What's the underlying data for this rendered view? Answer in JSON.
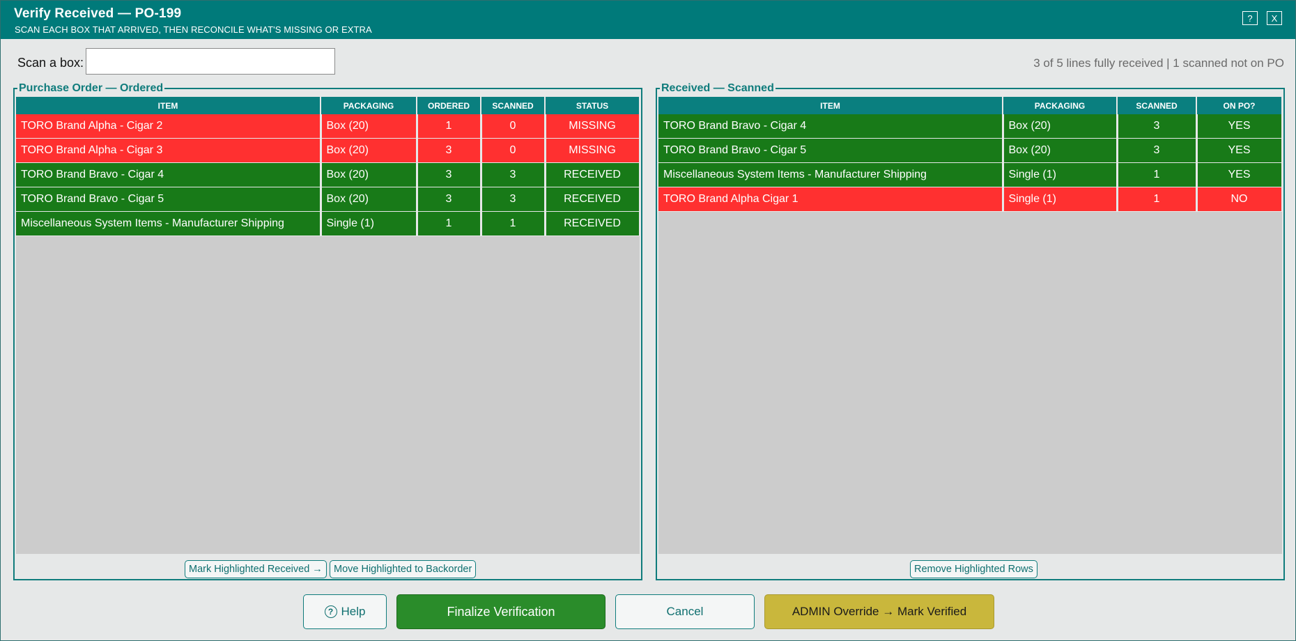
{
  "window": {
    "title": "Verify Received — PO-199",
    "subtitle": "SCAN EACH BOX THAT ARRIVED, THEN RECONCILE WHAT'S MISSING OR EXTRA",
    "help_label": "?",
    "close_label": "X"
  },
  "scan": {
    "label": "Scan a box:",
    "value": "",
    "placeholder": ""
  },
  "summary": "3 of 5 lines fully received | 1 scanned not on PO",
  "ordered_panel": {
    "title": "Purchase Order — Ordered",
    "columns": [
      "ITEM",
      "PACKAGING",
      "ORDERED",
      "SCANNED",
      "STATUS"
    ],
    "rows": [
      {
        "item": "TORO Brand Alpha - Cigar 2",
        "packaging": "Box (20)",
        "ordered": "1",
        "scanned": "0",
        "status": "MISSING",
        "color": "#ff3030"
      },
      {
        "item": "TORO Brand Alpha - Cigar 3",
        "packaging": "Box (20)",
        "ordered": "3",
        "scanned": "0",
        "status": "MISSING",
        "color": "#ff3030"
      },
      {
        "item": "TORO Brand Bravo - Cigar 4",
        "packaging": "Box (20)",
        "ordered": "3",
        "scanned": "3",
        "status": "RECEIVED",
        "color": "#187a18"
      },
      {
        "item": "TORO Brand Bravo - Cigar 5",
        "packaging": "Box (20)",
        "ordered": "3",
        "scanned": "3",
        "status": "RECEIVED",
        "color": "#187a18"
      },
      {
        "item": "Miscellaneous System Items - Manufacturer Shipping",
        "packaging": "Single (1)",
        "ordered": "1",
        "scanned": "1",
        "status": "RECEIVED",
        "color": "#187a18"
      }
    ],
    "mark_received_label": "Mark Highlighted Received →",
    "backorder_label": "Move Highlighted to Backorder"
  },
  "scanned_panel": {
    "title": "Received — Scanned",
    "columns": [
      "ITEM",
      "PACKAGING",
      "SCANNED",
      "ON PO?"
    ],
    "rows": [
      {
        "item": "TORO Brand Bravo - Cigar 4",
        "packaging": "Box (20)",
        "scanned": "3",
        "on_po": "YES",
        "color": "#187a18"
      },
      {
        "item": "TORO Brand Bravo - Cigar 5",
        "packaging": "Box (20)",
        "scanned": "3",
        "on_po": "YES",
        "color": "#187a18"
      },
      {
        "item": "Miscellaneous System Items - Manufacturer Shipping",
        "packaging": "Single (1)",
        "scanned": "1",
        "on_po": "YES",
        "color": "#187a18"
      },
      {
        "item": "TORO Brand Alpha Cigar 1",
        "packaging": "Single (1)",
        "scanned": "1",
        "on_po": "NO",
        "color": "#ff3030"
      }
    ],
    "remove_label": "Remove Highlighted Rows"
  },
  "buttons": {
    "help_label": "Help",
    "help_icon": "question-circle-icon",
    "finalize_label": "Finalize Verification",
    "cancel_label": "Cancel",
    "admin_label": "ADMIN Override → Mark Verified"
  },
  "colors": {
    "teal": "#007a7a",
    "missing": "#ff3030",
    "received": "#187a18",
    "finalize": "#2a8c2a",
    "admin": "#c9b73c"
  }
}
